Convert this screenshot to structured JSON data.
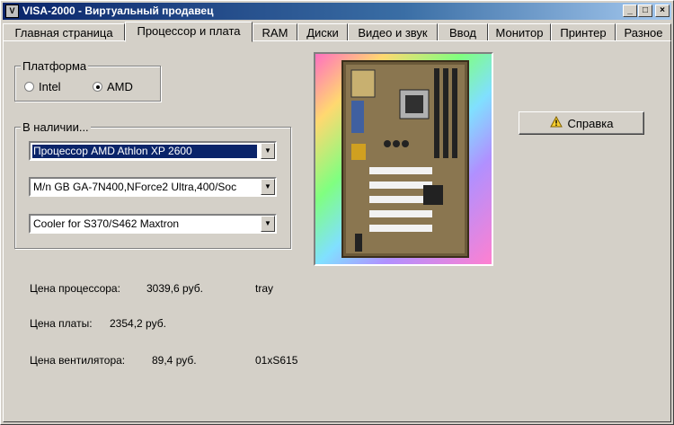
{
  "window": {
    "title": "VISA-2000 - Виртуальный продавец"
  },
  "titlebar_buttons": {
    "minimize": "_",
    "maximize": "□",
    "close": "×"
  },
  "tabs": [
    {
      "label": "Главная страница",
      "active": false
    },
    {
      "label": "Процессор и плата",
      "active": true
    },
    {
      "label": "RAM",
      "active": false
    },
    {
      "label": "Диски",
      "active": false
    },
    {
      "label": "Видео и звук",
      "active": false
    },
    {
      "label": "Ввод",
      "active": false
    },
    {
      "label": "Монитор",
      "active": false
    },
    {
      "label": "Принтер",
      "active": false
    },
    {
      "label": "Разное",
      "active": false
    }
  ],
  "platform": {
    "label": "Платформа",
    "options": [
      {
        "label": "Intel",
        "selected": false
      },
      {
        "label": "AMD",
        "selected": true
      }
    ]
  },
  "in_stock": {
    "label": "В наличии...",
    "processor": "Процессор  AMD Athlon XP 2600",
    "motherboard": "M/n GB GA-7N400,NForce2 Ultra,400/Soc",
    "cooler": "Cooler for S370/S462 Maxtron"
  },
  "help_button": {
    "label": "Справка"
  },
  "prices": {
    "processor": {
      "label": "Цена процессора:",
      "value": "3039,6 руб.",
      "note": "tray"
    },
    "board": {
      "label": "Цена платы:",
      "value": "2354,2 руб."
    },
    "cooler": {
      "label": "Цена вентилятора:",
      "value": "89,4 руб.",
      "note": "01xS615"
    }
  },
  "colors": {
    "title_bar": "#0a246a",
    "window_face": "#d4d0c8",
    "selection": "#0a246a"
  },
  "icons": {
    "help": "warning-help-icon",
    "combo_arrow": "arrow-down-icon",
    "app": "app-icon"
  }
}
